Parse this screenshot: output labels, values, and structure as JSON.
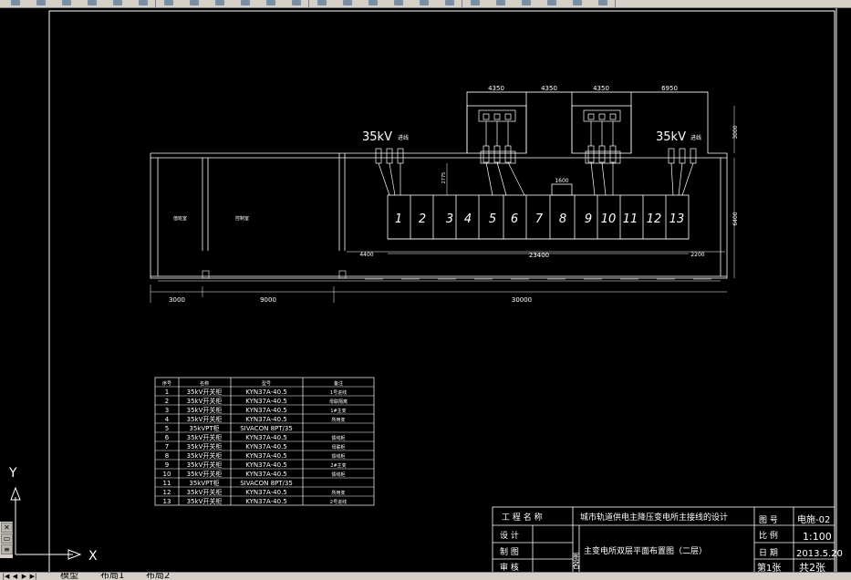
{
  "colors": {
    "background": "#000000",
    "lines": "#ffffff",
    "toolbar": "#d4d0c8"
  },
  "toolbar": {
    "icon_count": 24
  },
  "plan": {
    "dim_top": [
      "4350",
      "4350",
      "4350",
      "6950"
    ],
    "dim_right_top": "3000",
    "dim_right_side": "6400",
    "dim_2775": "2775",
    "dim_1600": "1600",
    "dim_4400": "4400",
    "dim_23400": "23400",
    "dim_2200": "2200",
    "dim_bottom": [
      "3000",
      "9000",
      "30000"
    ],
    "label_35kv_left": "35kV",
    "label_35kv_right": "35kV",
    "label_incoming": "进线",
    "room_left": "值班室",
    "room_mid": "控制室",
    "cabinets": [
      "1",
      "2",
      "3",
      "4",
      "5",
      "6",
      "7",
      "8",
      "9",
      "10",
      "11",
      "12",
      "13"
    ]
  },
  "equipment_table": {
    "headers": [
      "序号",
      "名称",
      "型号",
      "备注"
    ],
    "rows": [
      [
        "1",
        "35kV开关柜",
        "KYN37A-40.5",
        "1号进线"
      ],
      [
        "2",
        "35kV开关柜",
        "KYN37A-40.5",
        "母联隔离"
      ],
      [
        "3",
        "35kV开关柜",
        "KYN37A-40.5",
        "1#主变"
      ],
      [
        "4",
        "35kV开关柜",
        "KYN37A-40.5",
        "所用变"
      ],
      [
        "5",
        "35kVPT柜",
        "SIVACON 8PT/35",
        ""
      ],
      [
        "6",
        "35kV开关柜",
        "KYN37A-40.5",
        "馈线柜"
      ],
      [
        "7",
        "35kV开关柜",
        "KYN37A-40.5",
        "母联柜"
      ],
      [
        "8",
        "35kV开关柜",
        "KYN37A-40.5",
        "馈线柜"
      ],
      [
        "9",
        "35kV开关柜",
        "KYN37A-40.5",
        "2#主变"
      ],
      [
        "10",
        "35kV开关柜",
        "KYN37A-40.5",
        "馈线柜"
      ],
      [
        "11",
        "35kVPT柜",
        "SIVACON 8PT/35",
        ""
      ],
      [
        "12",
        "35kV开关柜",
        "KYN37A-40.5",
        "所用变"
      ],
      [
        "13",
        "35kV开关柜",
        "KYN37A-40.5",
        "2号进线"
      ]
    ]
  },
  "title_block": {
    "project_label": "工 程 名 称",
    "project_name": "城市轨道供电主降压变电所主接线的设计",
    "drawing_no_label": "图 号",
    "drawing_no": "电施-02",
    "design_label": "设 计",
    "scale_label": "比 例",
    "scale": "1:100",
    "draw_label": "制 图",
    "figure_name_label": "图名",
    "figure_name": "主变电所双层平面布置图（二层）",
    "date_label": "日 期",
    "date": "2013.5.20",
    "review_label": "审 核",
    "sheet_label": "第1张",
    "sheet_total": "共2张"
  },
  "ucs": {
    "x_label": "X",
    "y_label": "Y"
  },
  "tabs": [
    {
      "label": "模型"
    },
    {
      "label": "布局1"
    },
    {
      "label": "布局2"
    }
  ]
}
